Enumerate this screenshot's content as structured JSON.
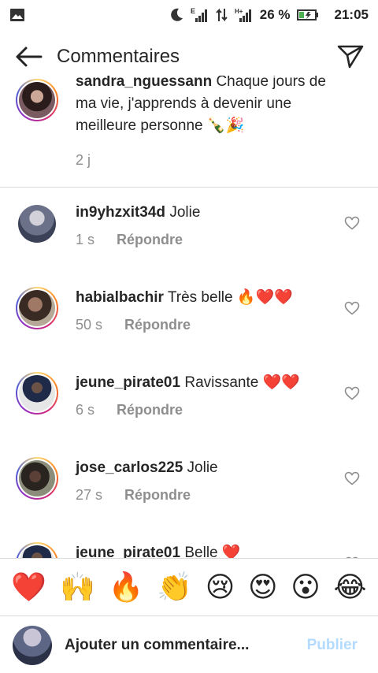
{
  "status_bar": {
    "signal_label": "E",
    "data_label": "H+",
    "battery_percent": "26 %",
    "time": "21:05"
  },
  "header": {
    "title": "Commentaires"
  },
  "caption": {
    "username": "sandra_nguessann",
    "text": "Chaque jours de ma vie, j'apprends à devenir une meilleure personne 🍾🎉",
    "time": "2 j"
  },
  "comments": [
    {
      "username": "in9yhzxit34d",
      "text": "Jolie",
      "time": "1 s",
      "reply_label": "Répondre"
    },
    {
      "username": "habialbachir",
      "text": "Très belle 🔥❤️❤️",
      "time": "50 s",
      "reply_label": "Répondre"
    },
    {
      "username": "jeune_pirate01",
      "text": "Ravissante ❤️❤️",
      "time": "6 s",
      "reply_label": "Répondre"
    },
    {
      "username": "jose_carlos225",
      "text": "Jolie",
      "time": "27 s",
      "reply_label": "Répondre"
    },
    {
      "username": "jeune_pirate01",
      "text": "Belle ❤️",
      "time": "",
      "reply_label": ""
    }
  ],
  "emoji_bar": [
    "❤️",
    "🙌",
    "🔥",
    "👏",
    "😢",
    "😍",
    "😮",
    "😂"
  ],
  "composer": {
    "placeholder": "Ajouter un commentaire...",
    "post_label": "Publier"
  },
  "colors": {
    "post_disabled": "#b3dbff",
    "muted_text": "#8e8e8e",
    "divider": "#dbdbdb"
  }
}
